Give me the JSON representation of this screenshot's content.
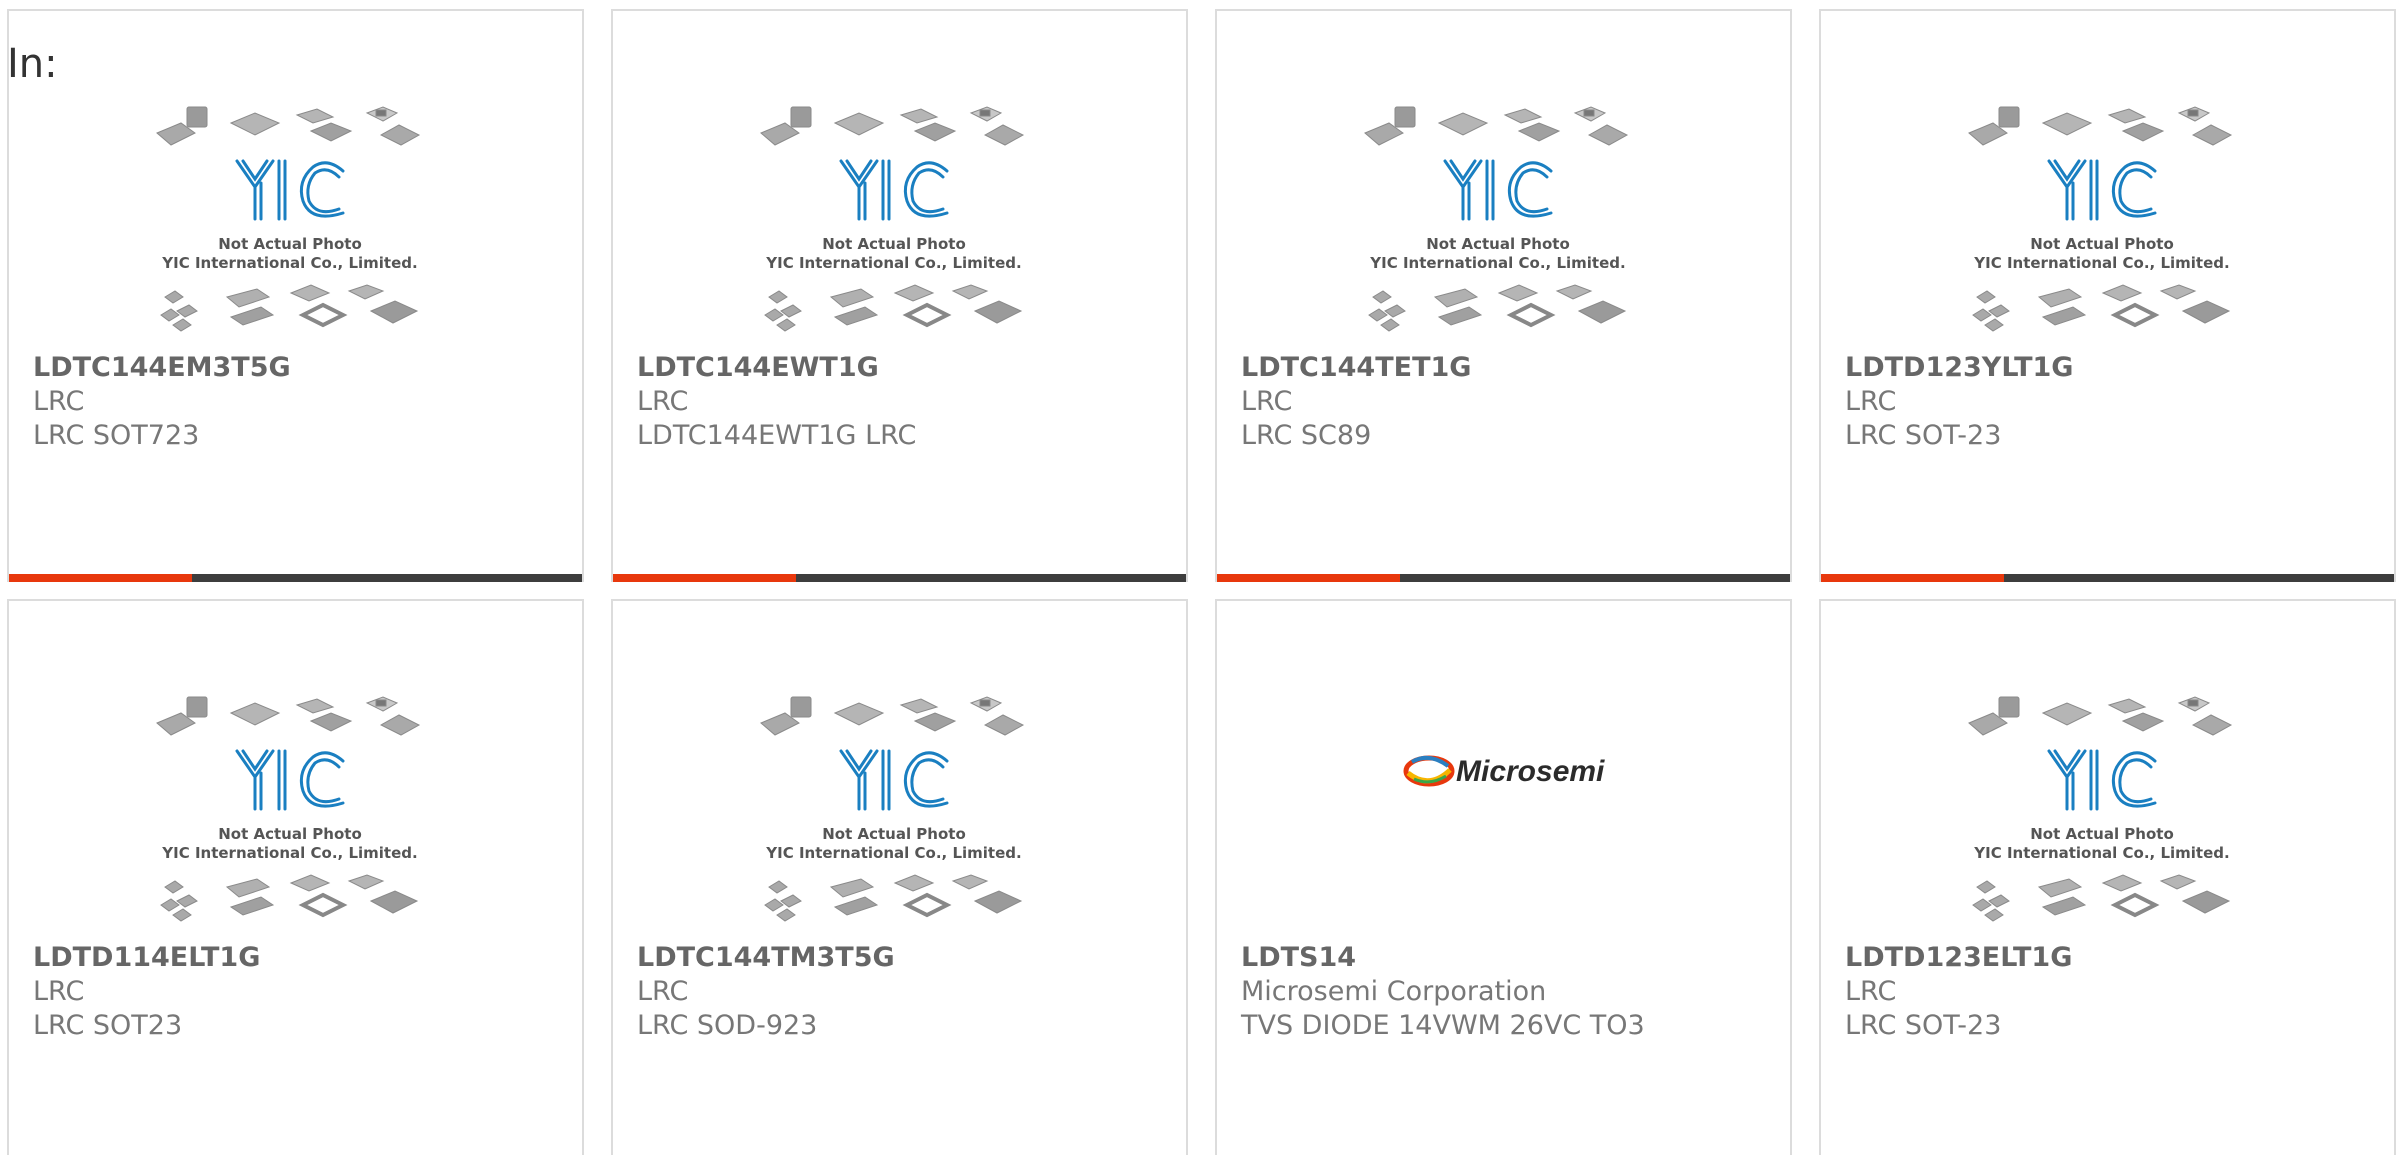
{
  "header": {
    "label": "In:"
  },
  "placeholder_image": {
    "caption_line1": "Not Actual Photo",
    "caption_line2": "YIC International Co., Limited.",
    "logo_text": "YIC"
  },
  "colors": {
    "accent": "#e8380d",
    "bar": "#3d3d3d",
    "logo_blue": "#1a7fc1",
    "border": "#dcdcdc"
  },
  "products": [
    {
      "part_number": "LDTC144EM3T5G",
      "manufacturer": "LRC",
      "description": "LRC SOT723",
      "image": "yic-placeholder"
    },
    {
      "part_number": "LDTC144EWT1G",
      "manufacturer": "LRC",
      "description": "LDTC144EWT1G LRC",
      "image": "yic-placeholder"
    },
    {
      "part_number": "LDTC144TET1G",
      "manufacturer": "LRC",
      "description": "LRC SC89",
      "image": "yic-placeholder"
    },
    {
      "part_number": "LDTD123YLT1G",
      "manufacturer": "LRC",
      "description": "LRC SOT-23",
      "image": "yic-placeholder"
    },
    {
      "part_number": "LDTD114ELT1G",
      "manufacturer": "LRC",
      "description": "LRC SOT23",
      "image": "yic-placeholder"
    },
    {
      "part_number": "LDTC144TM3T5G",
      "manufacturer": "LRC",
      "description": "LRC SOD-923",
      "image": "yic-placeholder"
    },
    {
      "part_number": "LDTS14",
      "manufacturer": "Microsemi Corporation",
      "description": "TVS DIODE 14VWM 26VC TO3",
      "image": "microsemi-logo",
      "logo_text": "Microsemi"
    },
    {
      "part_number": "LDTD123ELT1G",
      "manufacturer": "LRC",
      "description": "LRC SOT-23",
      "image": "yic-placeholder"
    }
  ]
}
